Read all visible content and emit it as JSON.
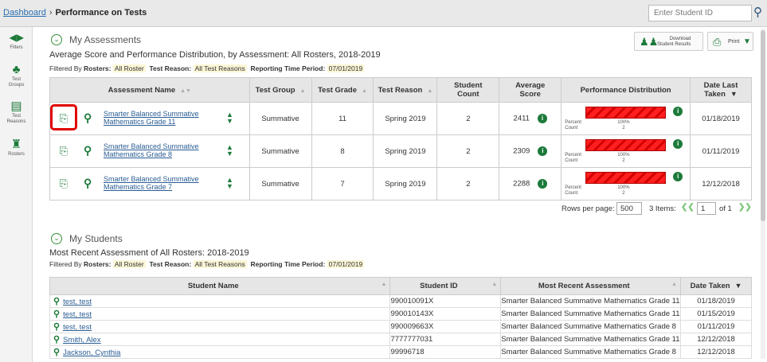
{
  "breadcrumb": {
    "home": "Dashboard",
    "sep": "›",
    "current": "Performance on Tests"
  },
  "search": {
    "placeholder": "Enter Student ID",
    "icon": "search-icon"
  },
  "rail": [
    {
      "label": "Filters",
      "icon": "filters-icon"
    },
    {
      "label": "Test Groups",
      "icon": "test-groups-icon"
    },
    {
      "label": "Test Reasons",
      "icon": "test-reasons-icon"
    },
    {
      "label": "Rosters",
      "icon": "rosters-icon"
    }
  ],
  "assessments": {
    "title": "My Assessments",
    "subtitle": "Average Score and Performance Distribution, by Assessment: All Rosters, 2018-2019",
    "filter": {
      "prefix": "Filtered By",
      "rosters_label": "Rosters:",
      "rosters": "All Roster",
      "reason_label": "Test Reason:",
      "reason": "All Test Reasons",
      "period_label": "Reporting Time Period:",
      "period": "07/01/2019"
    },
    "download_label_1": "Download",
    "download_label_2": "Student Results",
    "print_label": "Print",
    "columns": [
      "Assessment Name",
      "Test Group",
      "Test Grade",
      "Test Reason",
      "Student Count",
      "Average Score",
      "Performance Distribution",
      "Date Last Taken"
    ],
    "columns_split": {
      "student_count": [
        "Student",
        "Count"
      ],
      "average_score": [
        "Average",
        "Score"
      ],
      "date_last": [
        "Date Last",
        "Taken"
      ]
    },
    "rows": [
      {
        "name_1": "Smarter Balanced Summative",
        "name_2": "Mathematics Grade 11",
        "group": "Summative",
        "grade": "11",
        "reason": "Spring 2019",
        "count": "2",
        "score": "2411",
        "percent": "100%",
        "pcount": "2",
        "date": "01/18/2019"
      },
      {
        "name_1": "Smarter Balanced Summative",
        "name_2": "Mathematics Grade 8",
        "group": "Summative",
        "grade": "8",
        "reason": "Spring 2019",
        "count": "2",
        "score": "2309",
        "percent": "100%",
        "pcount": "2",
        "date": "01/11/2019"
      },
      {
        "name_1": "Smarter Balanced Summative",
        "name_2": "Mathematics Grade 7",
        "group": "Summative",
        "grade": "7",
        "reason": "Spring 2019",
        "count": "2",
        "score": "2288",
        "percent": "100%",
        "pcount": "2",
        "date": "12/12/2018"
      }
    ],
    "pd_labels": {
      "percent": "Percent",
      "count": "Count"
    },
    "pager": {
      "rows_label": "Rows per page:",
      "rows_value": "500",
      "items": "3 Items:",
      "page": "1",
      "of": "of 1"
    }
  },
  "students": {
    "title": "My Students",
    "subtitle": "Most Recent Assessment of All Rosters: 2018-2019",
    "filter": {
      "prefix": "Filtered By",
      "rosters_label": "Rosters:",
      "rosters": "All Roster",
      "reason_label": "Test Reason:",
      "reason": "All Test Reasons",
      "period_label": "Reporting Time Period:",
      "period": "07/01/2019"
    },
    "columns": [
      "Student Name",
      "Student ID",
      "Most Recent Assessment",
      "Date Taken"
    ],
    "rows": [
      {
        "name": "test, test",
        "id": "990010091X",
        "assessment": "Smarter Balanced Summative Mathematics Grade 11",
        "date": "01/18/2019"
      },
      {
        "name": "test, test",
        "id": "990010143X",
        "assessment": "Smarter Balanced Summative Mathematics Grade 11",
        "date": "01/15/2019"
      },
      {
        "name": "test, test",
        "id": "990009663X",
        "assessment": "Smarter Balanced Summative Mathematics Grade 8",
        "date": "01/11/2019"
      },
      {
        "name": "Smith, Alex",
        "id": "7777777031",
        "assessment": "Smarter Balanced Summative Mathematics Grade 11",
        "date": "12/12/2018"
      },
      {
        "name": "Jackson, Cynthia",
        "id": "99996718",
        "assessment": "Smarter Balanced Summative Mathematics Grade 8",
        "date": "12/12/2018"
      }
    ]
  },
  "colors": {
    "accent": "#1c7a3a",
    "link": "#2a5d94",
    "bar": "#e00000",
    "highlight": "#e00000"
  }
}
